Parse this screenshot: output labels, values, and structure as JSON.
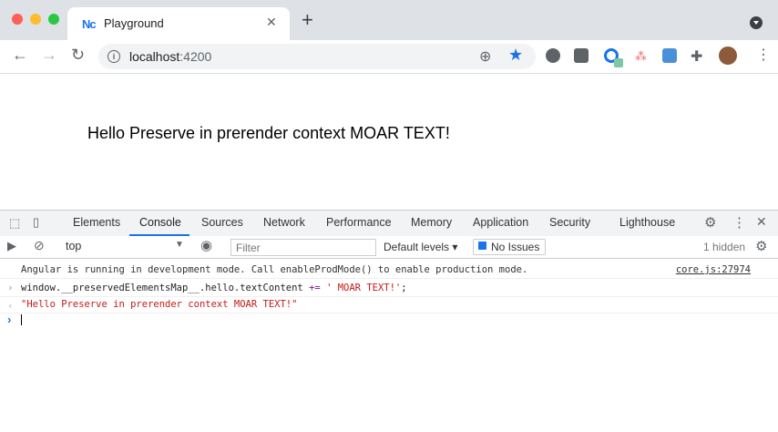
{
  "window": {
    "tab_favicon": "Nc",
    "tab_title": "Playground",
    "tab_close": "✕",
    "new_tab": "+"
  },
  "toolbar": {
    "url_host": "localhost",
    "url_port": ":4200"
  },
  "page": {
    "text": "Hello Preserve in prerender context MOAR TEXT!"
  },
  "devtools": {
    "tabs": [
      "Elements",
      "Console",
      "Sources",
      "Network",
      "Performance",
      "Memory",
      "Application",
      "Security",
      "Lighthouse"
    ],
    "active_tab": "Console",
    "context": "top",
    "filter_placeholder": "Filter",
    "levels": "Default levels ▾",
    "issues": "No Issues",
    "hidden": "1 hidden",
    "logs": {
      "info": "Angular is running in development mode. Call enableProdMode() to enable production mode.",
      "info_source": "core.js:27974",
      "input_prefix": "window.__preservedElementsMap__.hello.textContent ",
      "input_op": "+=",
      "input_string": "' MOAR TEXT!'",
      "input_suffix": ";",
      "result": "\"Hello Preserve in prerender context MOAR TEXT!\""
    }
  },
  "colors": {
    "accent": "#1a73e8",
    "string": "#c41a16",
    "keyword": "#881280"
  }
}
